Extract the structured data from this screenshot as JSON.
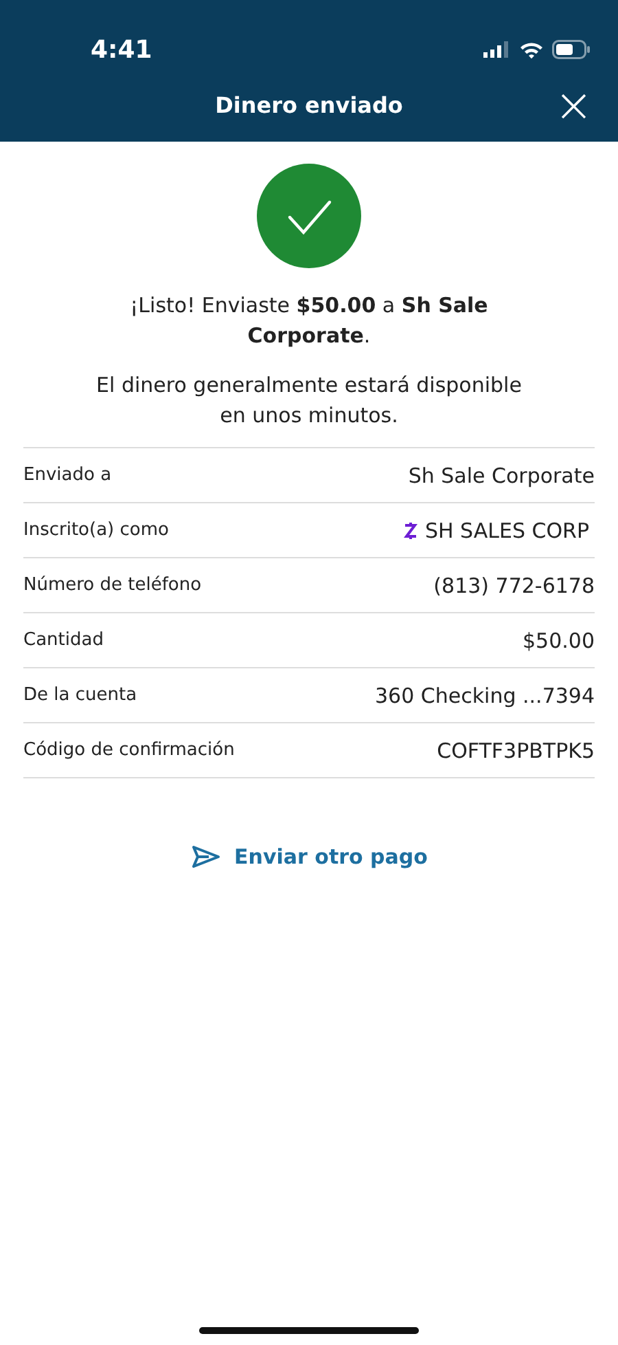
{
  "status_bar": {
    "time": "4:41"
  },
  "header": {
    "title": "Dinero enviado",
    "close": "×"
  },
  "message": "¡Listo! Enviaste **$50.00** a **Sh Sale Corporate**.",
  "note": "El dinero generalmente estará disponible en unos minutos.",
  "details": [
    {
      "label": "Enviado a",
      "value": "Sh Sale Corporate",
      "kind": "plain"
    },
    {
      "label": "Inscrito(a) como",
      "value": "SH SALES CORP",
      "kind": "zelle"
    },
    {
      "label": "Número de teléfono",
      "value": "(813) 772-6178",
      "kind": "plain"
    },
    {
      "label": "Cantidad",
      "value": "$50.00",
      "kind": "plain"
    },
    {
      "label": "De la cuenta",
      "value": "360 Checking ...7394",
      "kind": "plain"
    },
    {
      "label": "Código de confirmación",
      "value": "COFTF3PBTPK5",
      "kind": "plain"
    }
  ],
  "action": {
    "label": "Enviar otro pago"
  }
}
